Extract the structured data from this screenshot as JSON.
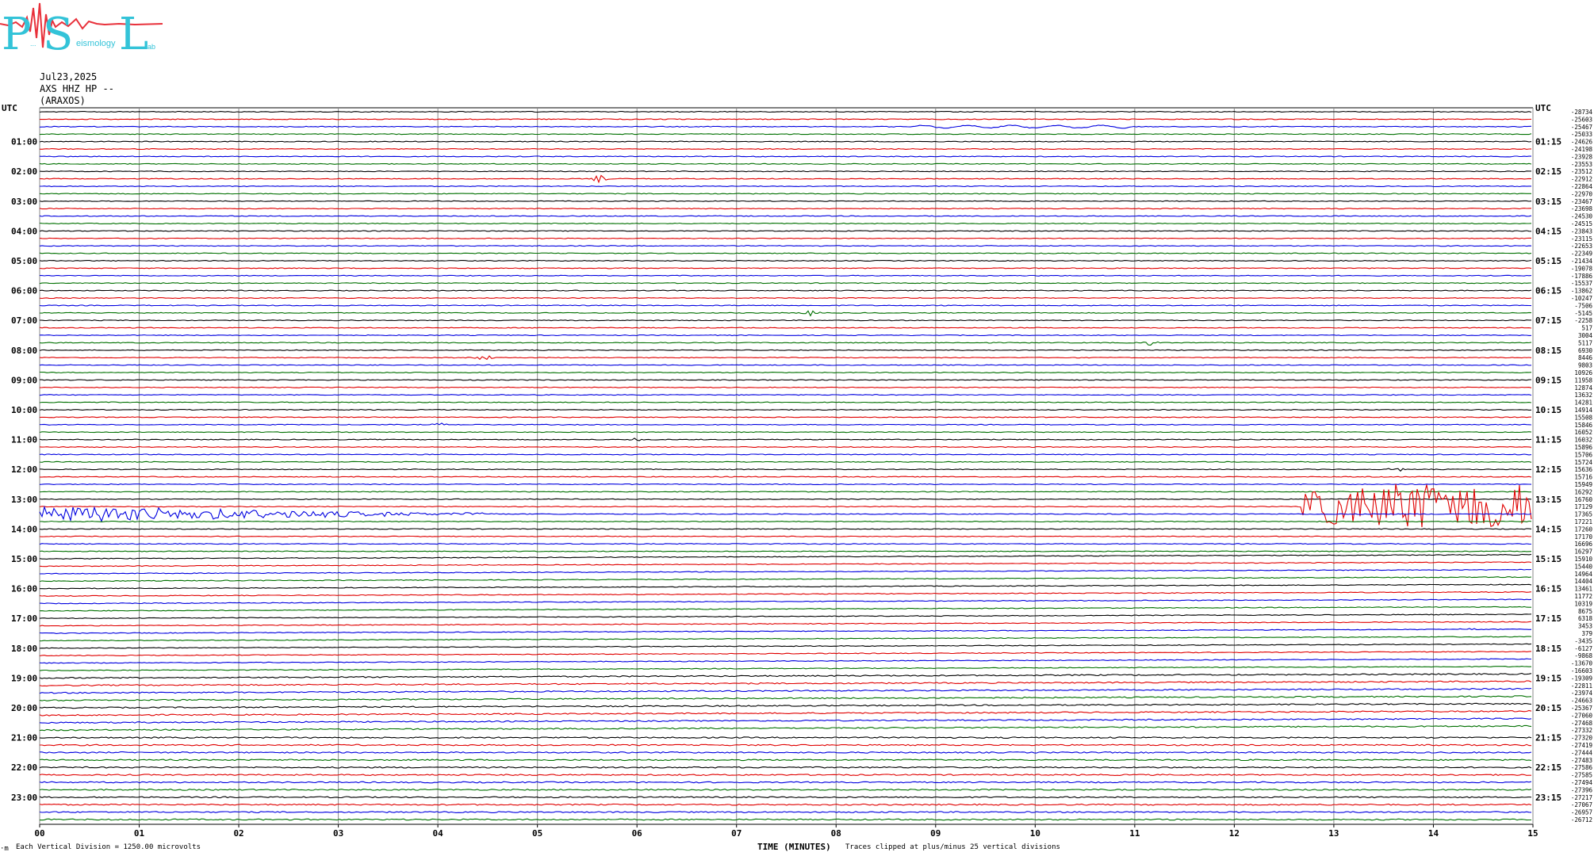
{
  "header": {
    "logo": {
      "letters": [
        "P",
        "S",
        "L"
      ],
      "small_words": [
        "...",
        "eismology",
        "ab"
      ],
      "colors": {
        "main": "#33c3d8",
        "wave": "#e8303a"
      }
    },
    "date": "Jul23,2025",
    "channel": "AXS HHZ HP --",
    "station": "(ARAXOS)"
  },
  "chart_data": {
    "type": "line",
    "subtype": "helicorder",
    "left_axis_label": "UTC",
    "right_axis_label": "UTC",
    "left_hour_labels": [
      "01:00",
      "02:00",
      "03:00",
      "04:00",
      "05:00",
      "06:00",
      "07:00",
      "08:00",
      "09:00",
      "10:00",
      "11:00",
      "12:00",
      "13:00",
      "14:00",
      "15:00",
      "16:00",
      "17:00",
      "18:00",
      "19:00",
      "20:00",
      "21:00",
      "22:00",
      "23:00"
    ],
    "right_hour_labels": [
      "01:15",
      "02:15",
      "03:15",
      "04:15",
      "05:15",
      "06:15",
      "07:15",
      "08:15",
      "09:15",
      "10:15",
      "11:15",
      "12:15",
      "13:15",
      "14:15",
      "15:15",
      "16:15",
      "17:15",
      "18:15",
      "19:15",
      "20:15",
      "21:15",
      "22:15",
      "23:15"
    ],
    "x_ticks": [
      "00",
      "01",
      "02",
      "03",
      "04",
      "05",
      "06",
      "07",
      "08",
      "09",
      "10",
      "11",
      "12",
      "13",
      "14",
      "15"
    ],
    "x_label": "TIME (MINUTES)",
    "xlim": [
      0,
      15
    ],
    "traces_per_hour": 4,
    "trace_count": 96,
    "trace_colors": [
      "#000000",
      "#e00000",
      "#0000e0",
      "#007000"
    ],
    "grid": true,
    "offsets": [
      "-28734",
      "-25603",
      "-25467",
      "-25033",
      "-24626",
      "-24198",
      "-23928",
      "-23553",
      "-23512",
      "-22912",
      "-22864",
      "-22970",
      "-23467",
      "-23698",
      "-24530",
      "-24515",
      "-23843",
      "-23115",
      "-22653",
      "-22349",
      "-21434",
      "-19078",
      "-17886",
      "-15537",
      "-13862",
      "-10247",
      "-7506",
      "-5145",
      "-2258",
      "517",
      "3004",
      "5117",
      "6930",
      "8446",
      "9803",
      "10926",
      "11958",
      "12874",
      "13632",
      "14281",
      "14914",
      "15508",
      "15846",
      "16052",
      "16032",
      "15896",
      "15706",
      "15724",
      "15636",
      "15716",
      "15949",
      "16292",
      "16760",
      "17129",
      "17365",
      "17221",
      "17260",
      "17170",
      "16696",
      "16297",
      "15910",
      "15440",
      "14964",
      "14404",
      "13461",
      "11772",
      "10319",
      "8675",
      "6318",
      "3453",
      "379",
      "-3435",
      "-6127",
      "-9868",
      "-13670",
      "-16603",
      "-19309",
      "-22811",
      "-23974",
      "-24663",
      "-25367",
      "-27060",
      "-27468",
      "-27332",
      "-27320",
      "-27419",
      "-27444",
      "-27483",
      "-27586",
      "-27585",
      "-27494",
      "-27396",
      "-27217",
      "-27067",
      "-26957",
      "-26712"
    ],
    "events": [
      {
        "trace": 9,
        "minute": 5.63,
        "amplitude_div": 1.4
      },
      {
        "trace": 27,
        "minute": 7.75,
        "amplitude_div": 1.3
      },
      {
        "trace": 33,
        "minute": 4.47,
        "amplitude_div": 1.3
      },
      {
        "trace": 31,
        "minute": 11.15,
        "amplitude_div": 1.2
      },
      {
        "trace": 42,
        "minute": 4.02,
        "amplitude_div": 0.8
      },
      {
        "trace": 44,
        "minute": 6.0,
        "amplitude_div": 0.8
      },
      {
        "trace": 48,
        "minute": 13.63,
        "amplitude_div": 1.0
      },
      {
        "trace": 70,
        "minute": 14.37,
        "amplitude_div": 1.0
      }
    ],
    "long_events": [
      {
        "trace": 54,
        "start_minute": 0.0,
        "end_minute": 4.6,
        "peak_amplitude_div": 3.2
      },
      {
        "trace": 53,
        "start_minute": 12.67,
        "end_minute": 15.0,
        "peak_amplitude_div": 9.0
      }
    ],
    "drift": {
      "from_trace": 60,
      "to_trace": 83,
      "slope_div": 1.6
    }
  },
  "footer": {
    "scale_note": "Each Vertical Division = 1250.00 microvolts",
    "clip_note": "Traces clipped at plus/minus 25 vertical divisions",
    "corner_mark": "·m"
  }
}
